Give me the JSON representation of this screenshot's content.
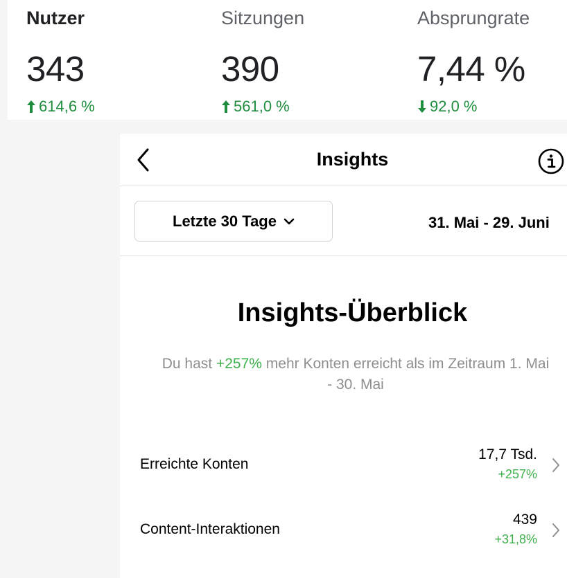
{
  "stats": [
    {
      "label": "Nutzer",
      "value": "343",
      "delta": "614,6 %",
      "direction": "up",
      "active": true
    },
    {
      "label": "Sitzungen",
      "value": "390",
      "delta": "561,0 %",
      "direction": "up",
      "active": false
    },
    {
      "label": "Absprungrate",
      "value": "7,44 %",
      "delta": "92,0 %",
      "direction": "down",
      "active": false
    }
  ],
  "header": {
    "title": "Insights",
    "back_icon": "chevron-left-icon",
    "info_icon": "info-icon"
  },
  "filter": {
    "range_label": "Letzte 30 Tage",
    "date_range": "31. Mai - 29. Juni"
  },
  "overview": {
    "title": "Insights-Überblick",
    "sub_prefix": "Du hast ",
    "sub_highlight": "+257%",
    "sub_suffix": " mehr Konten erreicht als im Zeitraum 1. Mai - 30. Mai"
  },
  "metrics": [
    {
      "label": "Erreichte Konten",
      "value": "17,7 Tsd.",
      "change": "+257%"
    },
    {
      "label": "Content-Interaktionen",
      "value": "439",
      "change": "+31,8%"
    }
  ],
  "colors": {
    "positive": "#3db04b",
    "delta_green": "#1e8e3e"
  }
}
